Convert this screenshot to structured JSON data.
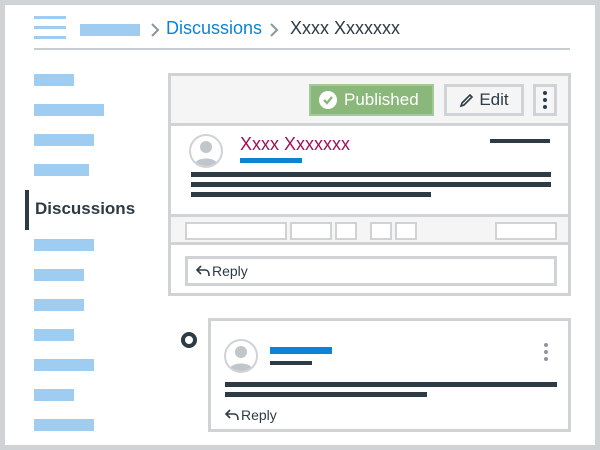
{
  "header": {
    "menu_icon": "hamburger-icon",
    "breadcrumb_link": "Discussions",
    "breadcrumb_current": "Xxxx Xxxxxxx"
  },
  "sidebar": {
    "active_label": "Discussions"
  },
  "post": {
    "status_label": "Published",
    "edit_label": "Edit",
    "author_name": "Xxxx Xxxxxxx",
    "reply_label": "Reply"
  },
  "reply": {
    "reply_label": "Reply"
  },
  "colors": {
    "accent": "#0b84d6",
    "author": "#a0115a",
    "published": "#8ab87a",
    "placeholder": "#9fcdf2",
    "border": "#cfd3d6",
    "text": "#2d3b45"
  },
  "icons": [
    "hamburger-icon",
    "chevron-right-icon",
    "check-circle-icon",
    "pencil-icon",
    "kebab-menu-icon",
    "user-avatar-icon",
    "reply-arrow-icon"
  ]
}
